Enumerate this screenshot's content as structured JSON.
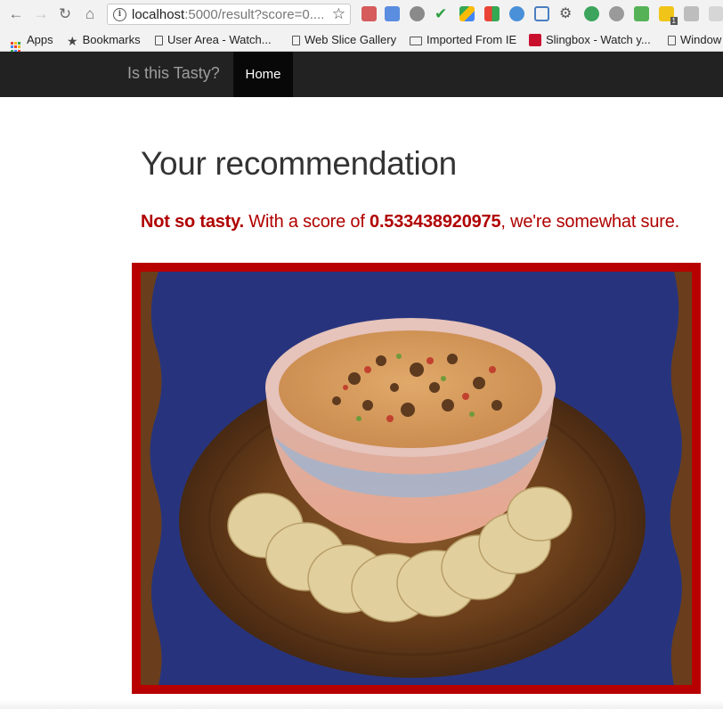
{
  "browser": {
    "url_host": "localhost",
    "url_rest": ":5000/result?score=0....",
    "bookmarks": [
      {
        "label": "Apps",
        "icon": "apps-grid-icon"
      },
      {
        "label": "Bookmarks",
        "icon": "star-icon"
      },
      {
        "label": "User Area - Watch...",
        "icon": "page-icon"
      },
      {
        "label": "Web Slice Gallery",
        "icon": "page-icon"
      },
      {
        "label": "Imported From IE",
        "icon": "folder-icon"
      },
      {
        "label": "Slingbox - Watch y...",
        "icon": "slingbox-icon"
      },
      {
        "label": "Window",
        "icon": "page-icon"
      }
    ],
    "extension_badge": "1"
  },
  "navbar": {
    "brand": "Is this Tasty?",
    "home_label": "Home"
  },
  "result": {
    "heading": "Your recommendation",
    "verdict": "Not so tasty.",
    "text_before_score": " With a score of ",
    "score": "0.533438920975",
    "text_after_score": ", we're somewhat sure.",
    "accent_color": "#b00000"
  }
}
